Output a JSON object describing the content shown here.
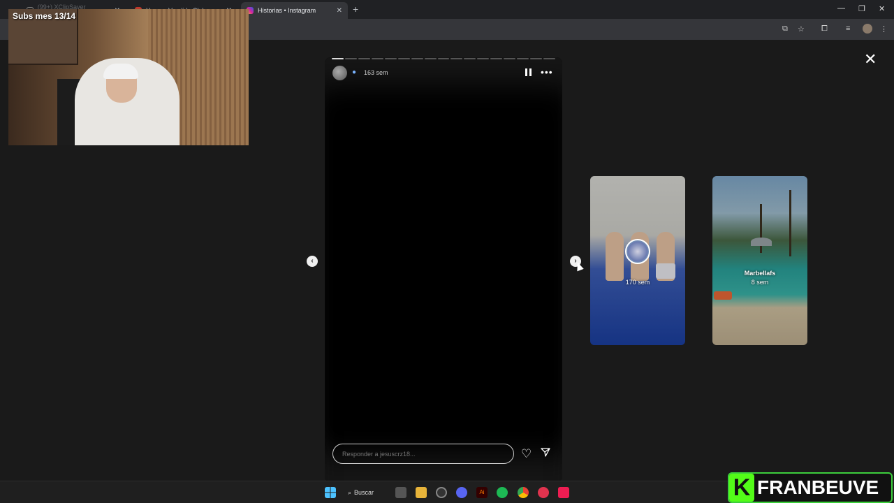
{
  "browser": {
    "tabs": [
      {
        "label": "(99+) XClipSaver (@clipsaver)"
      },
      {
        "label": "Home - Vandido Club"
      },
      {
        "label": "Historias • Instagram"
      }
    ],
    "new_tab": "+"
  },
  "webcam": {
    "caption": "Subs mes 13/14"
  },
  "story": {
    "segments_total": 17,
    "segments_done": 1,
    "time": "163 sem",
    "reply_placeholder": "Responder a jesuscrz18..."
  },
  "previews": [
    {
      "user": "",
      "time": "170 sem"
    },
    {
      "user": "Marbellafs",
      "time": "8 sem"
    }
  ],
  "taskbar": {
    "search_label": "Buscar"
  },
  "brand": {
    "letter": "K",
    "name": "FRANBEUVE"
  }
}
